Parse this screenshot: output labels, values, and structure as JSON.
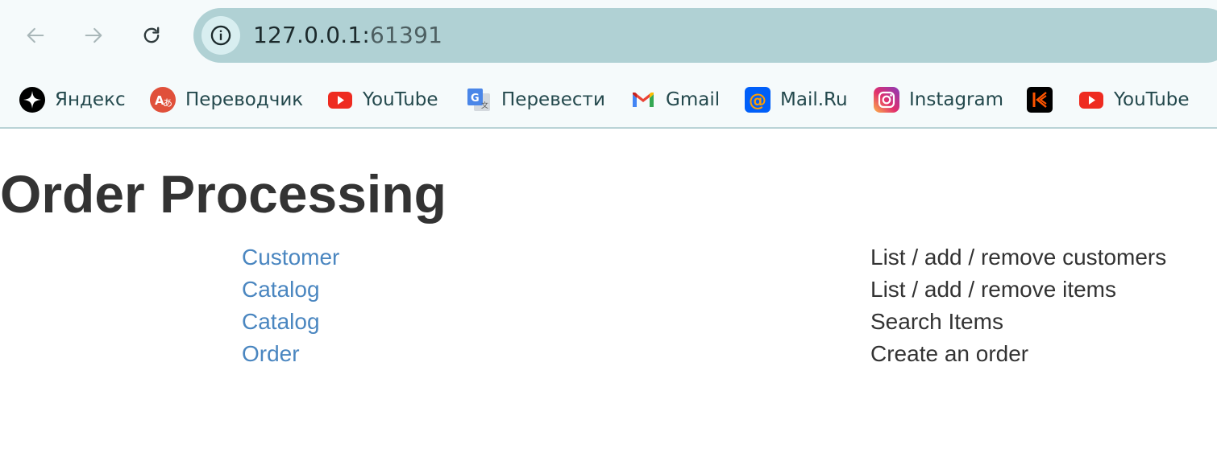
{
  "browser": {
    "url_host": "127.0.0.1:",
    "url_port": "61391",
    "bookmarks": [
      {
        "label": "Яндекс",
        "icon": "yandex-star-icon"
      },
      {
        "label": "Переводчик",
        "icon": "translator-icon"
      },
      {
        "label": "YouTube",
        "icon": "youtube-icon"
      },
      {
        "label": "Перевести",
        "icon": "google-translate-icon"
      },
      {
        "label": "Gmail",
        "icon": "gmail-icon"
      },
      {
        "label": "Mail.Ru",
        "icon": "mailru-icon"
      },
      {
        "label": "Instagram",
        "icon": "instagram-icon"
      },
      {
        "label": "",
        "icon": "kinopoisk-icon"
      },
      {
        "label": "YouTube",
        "icon": "youtube-icon"
      }
    ]
  },
  "page": {
    "title": "Order Processing",
    "rows": [
      {
        "link": "Customer",
        "description": "List / add / remove customers"
      },
      {
        "link": "Catalog",
        "description": "List / add / remove items"
      },
      {
        "link": "Catalog",
        "description": "Search Items"
      },
      {
        "link": "Order",
        "description": "Create an order"
      }
    ]
  },
  "colors": {
    "link": "#4a86c0",
    "text": "#333333",
    "omnibox": "#b0d1d4",
    "toolbar_bg": "#f5fafb"
  }
}
